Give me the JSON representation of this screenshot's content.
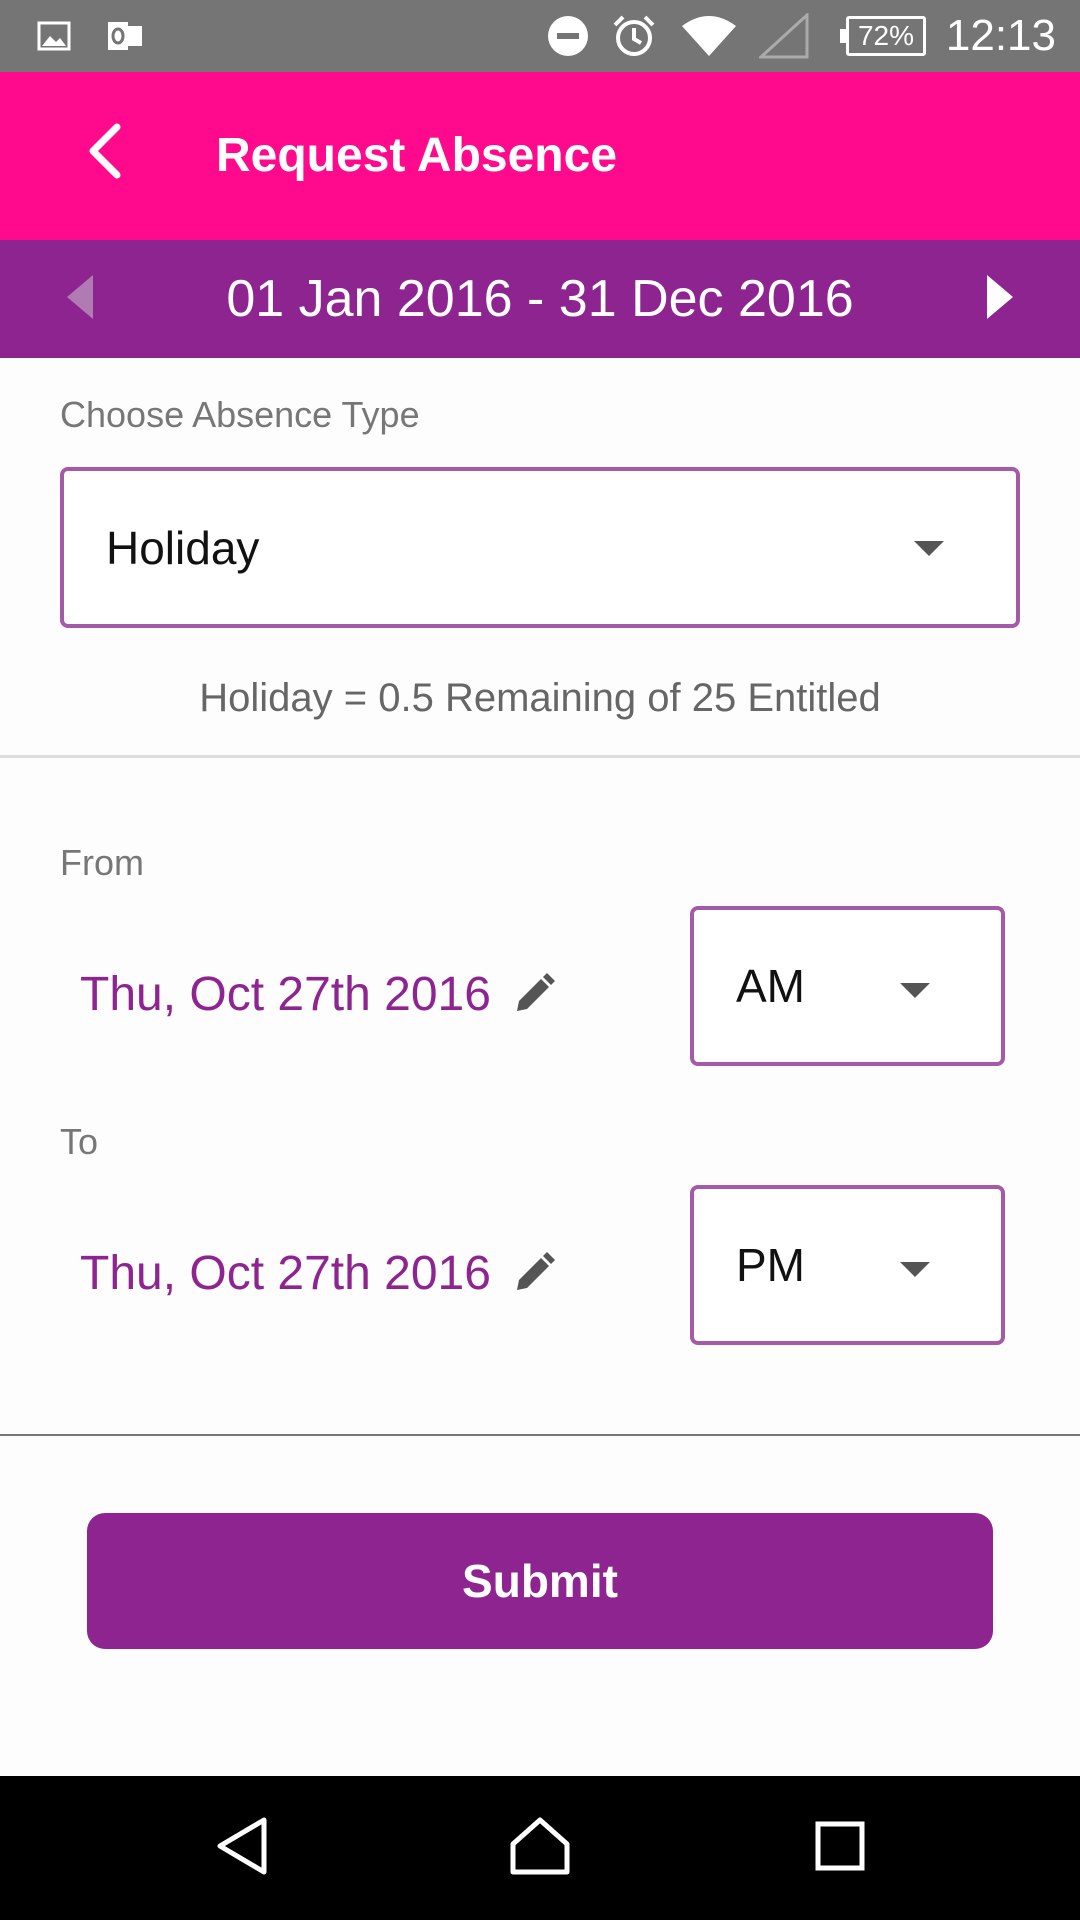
{
  "status_bar": {
    "icons": [
      "gallery-icon",
      "outlook-icon",
      "do-not-disturb-icon",
      "alarm-icon",
      "wifi-icon",
      "signal-icon"
    ],
    "battery": "72%",
    "time": "12:13"
  },
  "toolbar": {
    "back_icon": "chevron-left-icon",
    "title": "Request Absence"
  },
  "period": {
    "range": "01 Jan 2016 - 31 Dec 2016",
    "prev_icon": "triangle-left-icon",
    "next_icon": "triangle-right-icon"
  },
  "absence": {
    "label": "Choose Absence Type",
    "selected": "Holiday",
    "entitlement": "Holiday = 0.5 Remaining of 25 Entitled"
  },
  "from": {
    "label": "From",
    "date": "Thu, Oct 27th 2016",
    "half": "AM"
  },
  "to": {
    "label": "To",
    "date": "Thu, Oct 27th 2016",
    "half": "PM"
  },
  "submit_label": "Submit",
  "nav_bar": {
    "icons": [
      "back-triangle-icon",
      "home-icon",
      "recents-icon"
    ]
  },
  "colors": {
    "toolbar": "#ff0a8c",
    "period_bar": "#8e2490",
    "accent": "#8e2490",
    "field_border": "#a55aa8"
  }
}
